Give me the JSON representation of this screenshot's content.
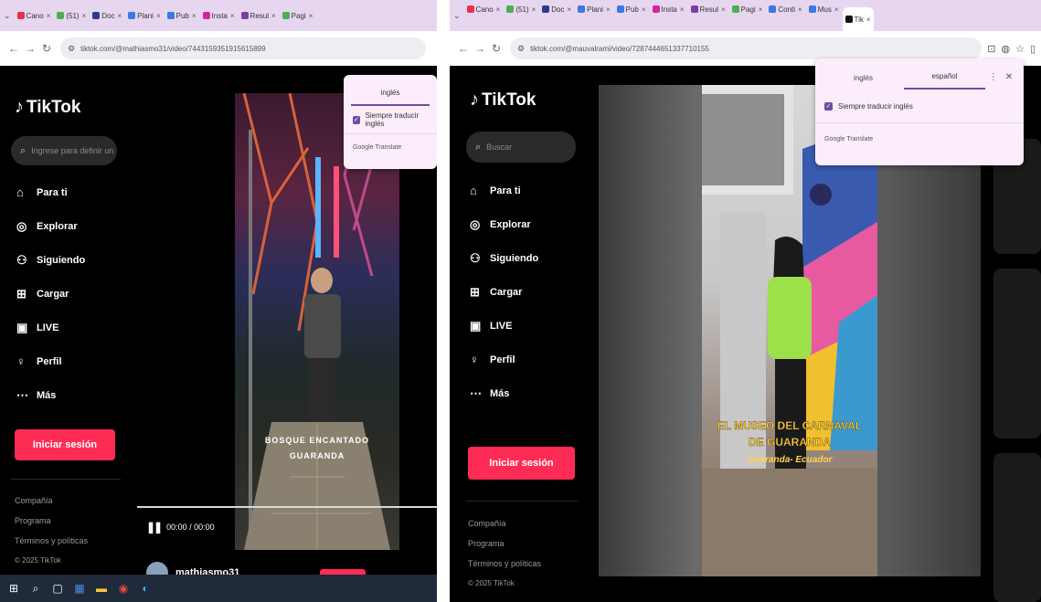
{
  "left": {
    "tabs": [
      {
        "label": "Cano",
        "color": "#e8304a"
      },
      {
        "label": "(51)",
        "color": "#4caf50"
      },
      {
        "label": "Doc",
        "color": "#2b3a8c"
      },
      {
        "label": "Plani",
        "color": "#3b78e7"
      },
      {
        "label": "Pub",
        "color": "#3b78e7"
      },
      {
        "label": "Insta",
        "color": "#d6249f"
      },
      {
        "label": "Resul",
        "color": "#7b3fa0"
      },
      {
        "label": "Pagi",
        "color": "#4caf50"
      }
    ],
    "url": "tiktok.com/@mathiasmo31/video/7443159351915615899",
    "search_placeholder": "Ingrese para definir un",
    "translate": {
      "lang1": "inglés",
      "always": "Siempre traducir inglés",
      "brand": "Google Translate"
    },
    "caption_line1": "BOSQUE ENCANTADO",
    "caption_line2": "GUARANDA",
    "time": "00:00 / 00:00",
    "creator": "mathiasmo31",
    "taskbar_icons": [
      "windows-icon",
      "search-icon",
      "task-view-icon",
      "store-icon",
      "file-explorer-icon",
      "chrome-icon",
      "edge-icon"
    ]
  },
  "right": {
    "tabs": [
      {
        "label": "Cano",
        "color": "#e8304a"
      },
      {
        "label": "(51)",
        "color": "#4caf50"
      },
      {
        "label": "Doc",
        "color": "#2b3a8c"
      },
      {
        "label": "Plani",
        "color": "#3b78e7"
      },
      {
        "label": "Pub",
        "color": "#3b78e7"
      },
      {
        "label": "Insta",
        "color": "#d6249f"
      },
      {
        "label": "Resul",
        "color": "#7b3fa0"
      },
      {
        "label": "Pagi",
        "color": "#4caf50"
      },
      {
        "label": "Conti",
        "color": "#3b78e7"
      },
      {
        "label": "Mus",
        "color": "#3b78e7"
      },
      {
        "label": "Tik",
        "color": "#111111"
      }
    ],
    "url": "tiktok.com/@mauvalrami/video/7287444651337710155",
    "search_placeholder": "Buscar",
    "translate": {
      "lang1": "inglés",
      "lang2": "español",
      "always": "Siempre traducir inglés",
      "brand": "Google Translate"
    },
    "caption_line1": "EL MUSEO DEL CARNAVAL",
    "caption_line2": "DE GUARANDA",
    "caption_line3": "Guaranda- Ecuador"
  },
  "common": {
    "logo": "TikTok",
    "nav": [
      {
        "label": "Para ti",
        "icon": "home-icon"
      },
      {
        "label": "Explorar",
        "icon": "compass-icon"
      },
      {
        "label": "Siguiendo",
        "icon": "following-icon"
      },
      {
        "label": "Cargar",
        "icon": "upload-icon"
      },
      {
        "label": "LIVE",
        "icon": "live-icon"
      },
      {
        "label": "Perfil",
        "icon": "profile-icon"
      },
      {
        "label": "Más",
        "icon": "more-icon"
      }
    ],
    "login": "Iniciar sesión",
    "footer": [
      "Compañía",
      "Programa",
      "Términos y políticas",
      "© 2025 TikTok"
    ],
    "accent": "#fe2c55"
  }
}
